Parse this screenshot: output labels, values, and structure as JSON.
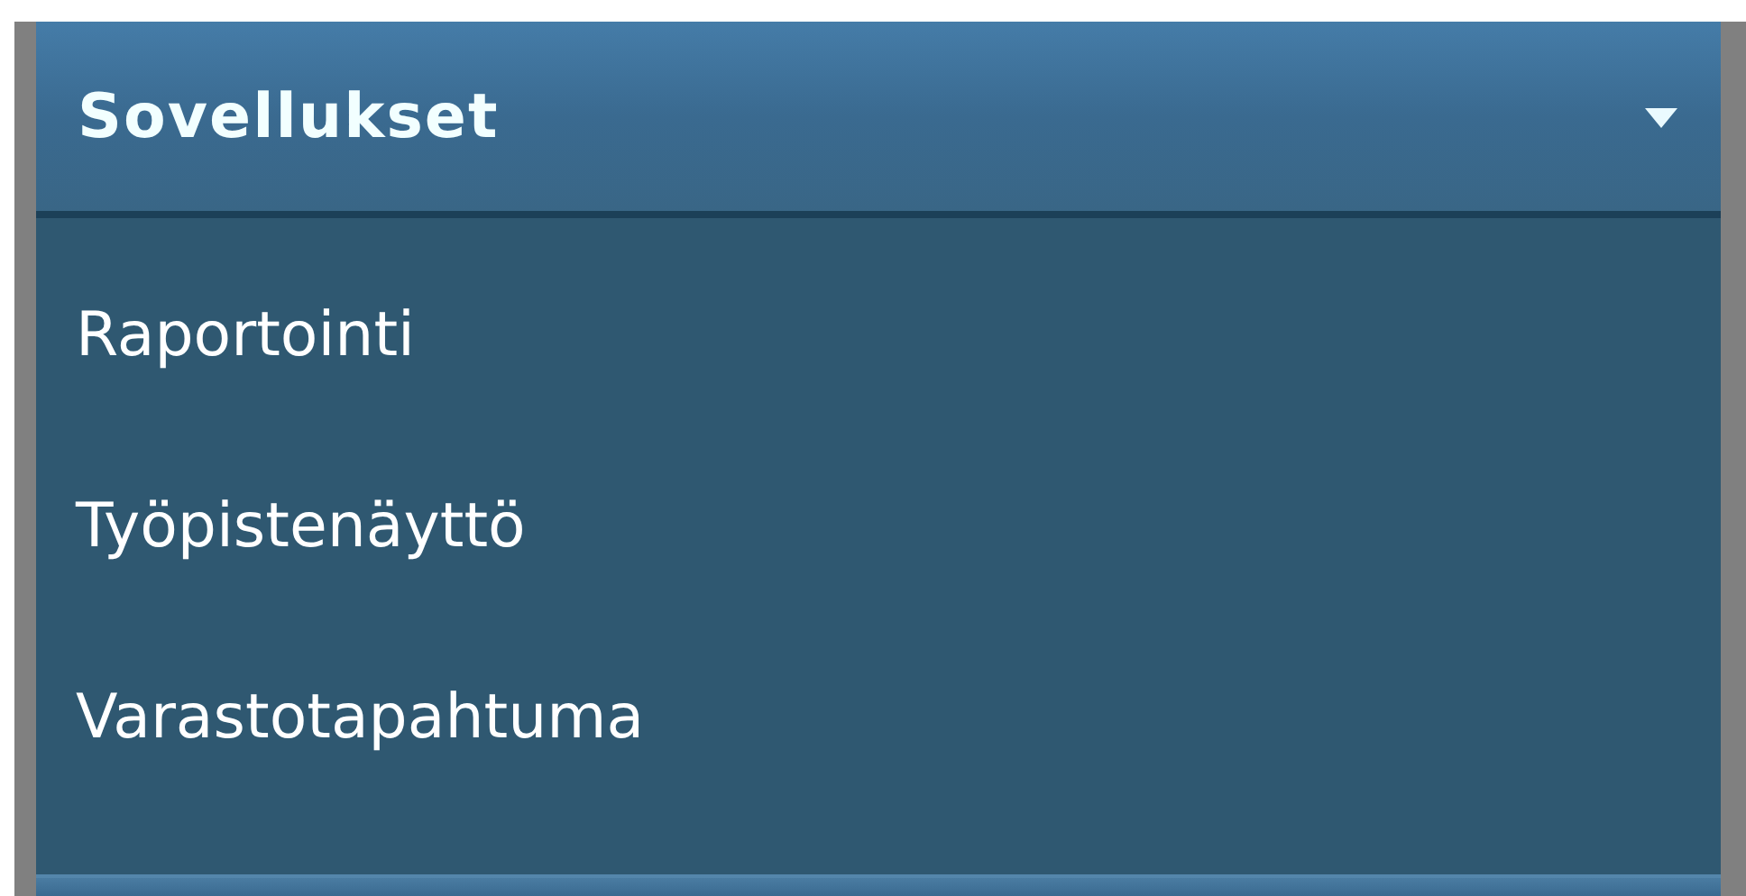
{
  "menu": {
    "title": "Sovellukset",
    "expanded": true,
    "items": [
      {
        "label": "Raportointi"
      },
      {
        "label": "Työpistenäyttö"
      },
      {
        "label": "Varastotapahtuma"
      }
    ]
  }
}
